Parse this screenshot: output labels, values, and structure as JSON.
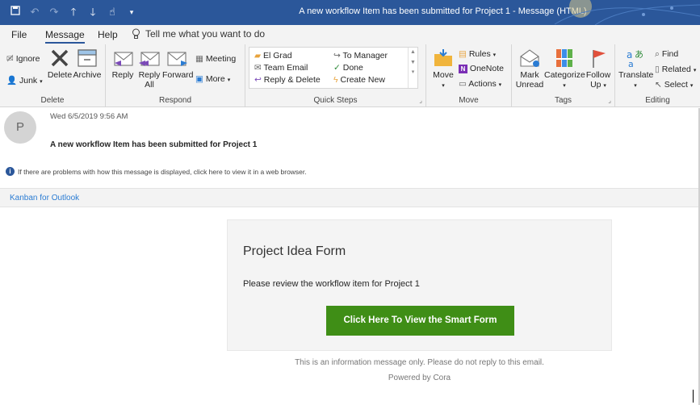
{
  "window": {
    "title": "A new workflow Item has been submitted for Project 1  -  Message (HTML)"
  },
  "menu": {
    "tabs": [
      "File",
      "Message",
      "Help"
    ],
    "active_tab": "Message",
    "tell_me": "Tell me what you want to do"
  },
  "ribbon": {
    "delete": {
      "label": "Delete",
      "ignore": "Ignore",
      "junk": "Junk",
      "delete": "Delete",
      "archive": "Archive"
    },
    "respond": {
      "label": "Respond",
      "reply": "Reply",
      "reply_all_1": "Reply",
      "reply_all_2": "All",
      "forward": "Forward",
      "meeting": "Meeting",
      "more": "More"
    },
    "quick_steps": {
      "label": "Quick Steps",
      "items": [
        "El Grad",
        "To Manager",
        "Team Email",
        "Done",
        "Reply & Delete",
        "Create New"
      ]
    },
    "move": {
      "label": "Move",
      "move": "Move",
      "rules": "Rules",
      "onenote": "OneNote",
      "actions": "Actions"
    },
    "tags": {
      "label": "Tags",
      "mark_1": "Mark",
      "mark_2": "Unread",
      "categorize": "Categorize",
      "follow_1": "Follow",
      "follow_2": "Up"
    },
    "editing": {
      "label": "Editing",
      "translate": "Translate",
      "find": "Find",
      "related": "Related",
      "select": "Select"
    }
  },
  "message": {
    "avatar_initial": "P",
    "date": "Wed 6/5/2019 9:56 AM",
    "subject": "A new workflow Item has been submitted for Project 1",
    "info": "If there are problems with how this message is displayed, click here to view it in a web browser.",
    "addin": "Kanban for Outlook"
  },
  "body": {
    "form_title": "Project Idea Form",
    "form_text": "Please review the workflow item for Project 1",
    "button": "Click Here To View the Smart Form",
    "footer_note": "This is an information message only. Please do not reply to this email.",
    "powered_by": "Powered by Cora"
  },
  "colors": {
    "title_bar": "#2b579a",
    "ribbon_bg": "#f3f3f3",
    "cta_green": "#3f8e16",
    "link_blue": "#2b7cd3"
  }
}
